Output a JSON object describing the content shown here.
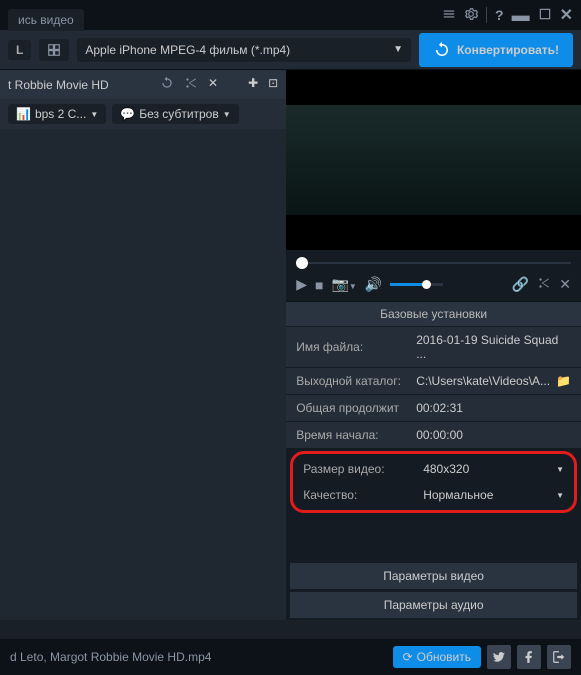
{
  "titlebar": {
    "tab": "ись видео"
  },
  "toolbar": {
    "badge": "L",
    "format": "Apple iPhone MPEG-4 фильм (*.mp4)",
    "convert": "Конвертировать!"
  },
  "file": {
    "name": "t Robbie Movie HD"
  },
  "chips": {
    "codec": "bps 2 C...",
    "subtitle": "Без субтитров"
  },
  "section": {
    "basic": "Базовые установки"
  },
  "props": {
    "filename_label": "Имя файла:",
    "filename_value": "2016-01-19 Suicide Squad ...",
    "outdir_label": "Выходной каталог:",
    "outdir_value": "C:\\Users\\kate\\Videos\\A...",
    "duration_label": "Общая продолжит",
    "duration_value": "00:02:31",
    "start_label": "Время начала:",
    "start_value": "00:00:00",
    "size_label": "Размер видео:",
    "size_value": "480x320",
    "quality_label": "Качество:",
    "quality_value": "Нормальное"
  },
  "buttons": {
    "video_params": "Параметры видео",
    "audio_params": "Параметры аудио",
    "update": "Обновить"
  },
  "status": {
    "file": "d Leto, Margot Robbie Movie HD.mp4"
  }
}
